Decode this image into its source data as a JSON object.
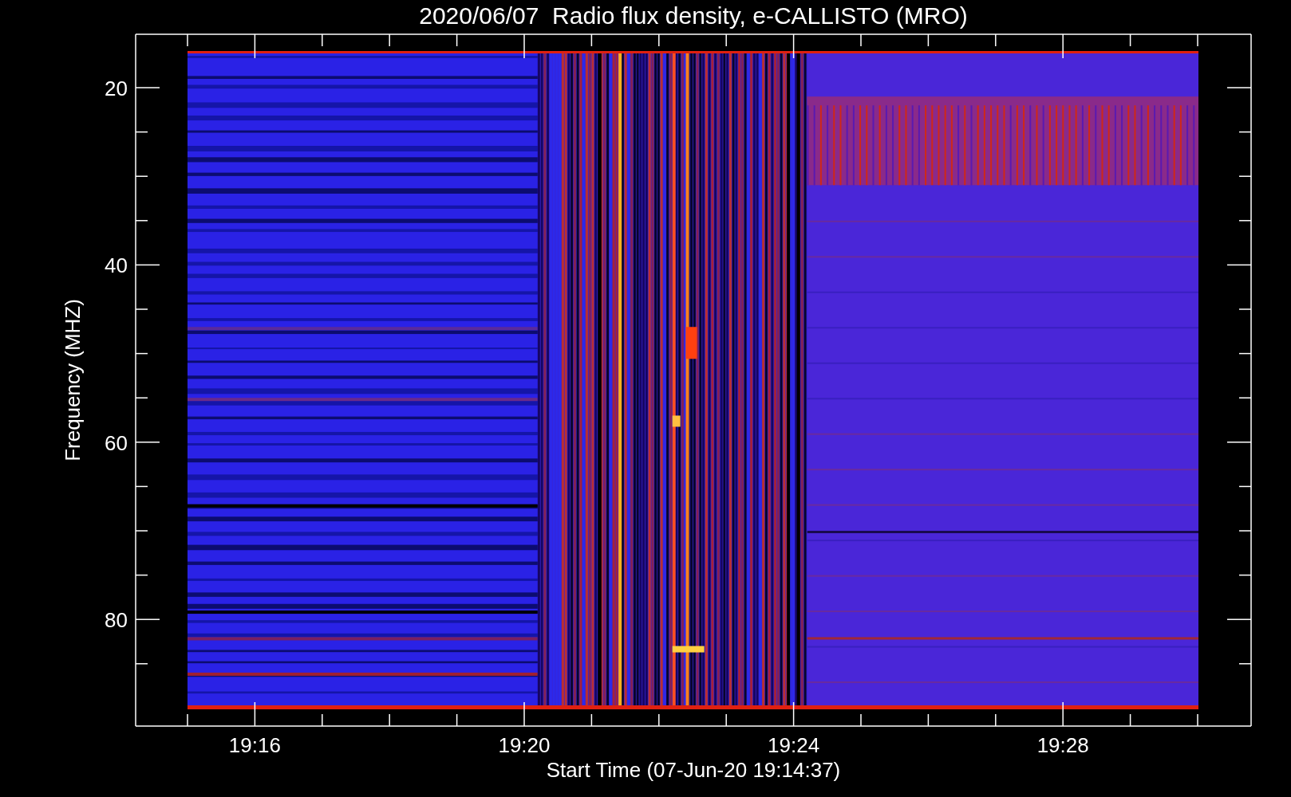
{
  "title": "2020/06/07  Radio flux density, e-CALLISTO (MRO)",
  "ylabel": "Frequency (MHZ)",
  "xlabel": "Start Time (07-Jun-20 19:14:37)",
  "yticks": [
    "20",
    "40",
    "60",
    "80"
  ],
  "xticks": [
    "19:16",
    "19:20",
    "19:24",
    "19:28"
  ]
}
